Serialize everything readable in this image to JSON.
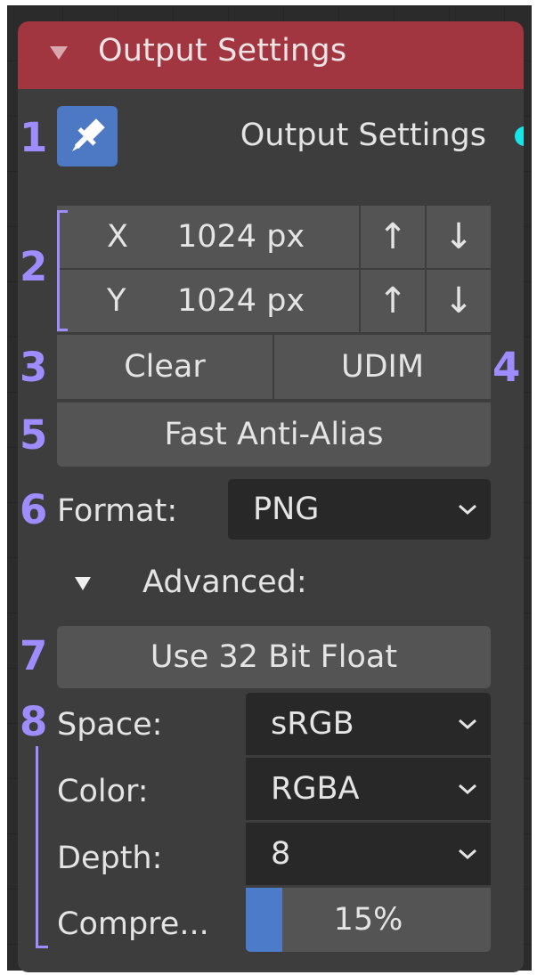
{
  "node": {
    "title": "Output Settings",
    "colors": {
      "header": "#a23640",
      "marker": "#9f8dff",
      "socket": "#17e6e8",
      "slider_fill": "#4b7bc9"
    }
  },
  "socket": {
    "label": "Output Settings"
  },
  "resolution": {
    "x_label": "X",
    "x_value": "1024 px",
    "y_label": "Y",
    "y_value": "1024 px",
    "up_glyph": "↑",
    "down_glyph": "↓"
  },
  "buttons": {
    "clear": "Clear",
    "udim": "UDIM",
    "fast_aa": "Fast Anti-Alias",
    "float32": "Use 32 Bit Float"
  },
  "format": {
    "label": "Format:",
    "value": "PNG"
  },
  "advanced": {
    "label": "Advanced:"
  },
  "settings": {
    "space": {
      "label": "Space:",
      "value": "sRGB"
    },
    "color": {
      "label": "Color:",
      "value": "RGBA"
    },
    "depth": {
      "label": "Depth:",
      "value": "8"
    },
    "compression": {
      "label": "Compre...",
      "value_text": "15%",
      "value": 0.15
    }
  },
  "markers": [
    "1",
    "2",
    "3",
    "4",
    "5",
    "6",
    "7",
    "8"
  ]
}
